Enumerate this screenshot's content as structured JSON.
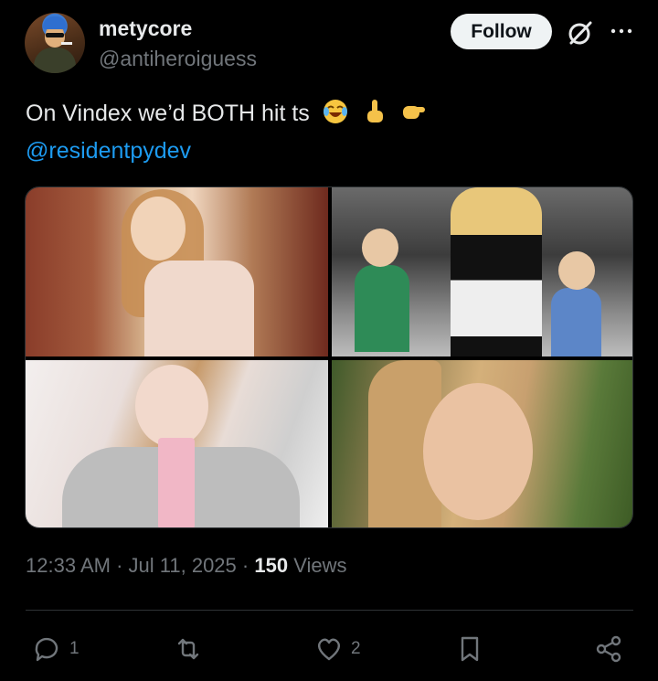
{
  "author": {
    "display_name": "metycore",
    "handle": "@antiheroiguess",
    "avatar_icon": "avatar"
  },
  "header": {
    "follow_label": "Follow",
    "grok_icon": "grok-icon",
    "more_icon": "more-icon"
  },
  "tweet": {
    "text": "On Vindex we’d BOTH hit ts",
    "emojis": [
      "face-with-tears-of-joy",
      "index-pointing-up",
      "backhand-index-pointing-right"
    ],
    "mention": "@residentpydev"
  },
  "media": {
    "count": 4
  },
  "meta": {
    "time": "12:33 AM",
    "date": "Jul 11, 2025",
    "views_count": "150",
    "views_label": "Views",
    "sep": "·"
  },
  "actions": {
    "reply_count": "1",
    "repost_count": "",
    "like_count": "2"
  },
  "colors": {
    "background": "#000000",
    "text": "#e7e9ea",
    "muted": "#71767b",
    "link": "#1d9bf0",
    "follow_bg": "#eff3f4"
  }
}
